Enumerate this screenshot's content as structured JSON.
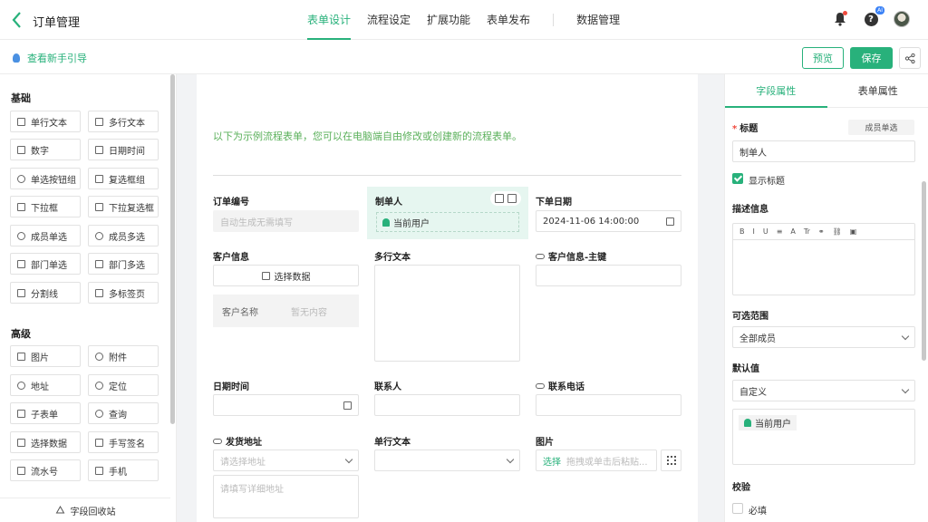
{
  "header": {
    "back_icon": "chevron-left-icon",
    "title": "订单管理",
    "tabs": [
      {
        "label": "表单设计",
        "active": true
      },
      {
        "label": "流程设定",
        "active": false
      },
      {
        "label": "扩展功能",
        "active": false
      },
      {
        "label": "表单发布",
        "active": false
      }
    ],
    "data_tab": "数据管理",
    "ai_badge": "AI",
    "help_glyph": "?"
  },
  "subbar": {
    "guide": "查看新手引导",
    "preview": "预览",
    "save": "保存"
  },
  "left_panel": {
    "basic_title": "基础",
    "basic_items": [
      "单行文本",
      "多行文本",
      "数字",
      "日期时间",
      "单选按钮组",
      "复选框组",
      "下拉框",
      "下拉复选框",
      "成员单选",
      "成员多选",
      "部门单选",
      "部门多选",
      "分割线",
      "多标签页"
    ],
    "advanced_title": "高级",
    "advanced_items": [
      "图片",
      "附件",
      "地址",
      "定位",
      "子表单",
      "查询",
      "选择数据",
      "手写签名",
      "流水号",
      "手机"
    ],
    "recycle": "字段回收站"
  },
  "canvas": {
    "intro": "以下为示例流程表单，您可以在电脑端自由修改或创建新的流程表单。",
    "fields": {
      "order_no_label": "订单编号",
      "order_no_placeholder": "自动生成无需填写",
      "creator_label": "制单人",
      "creator_value": "当前用户",
      "order_date_label": "下单日期",
      "order_date_value": "2024-11-06 14:00:00",
      "customer_label": "客户信息",
      "select_data": "选择数据",
      "customer_name_col": "客户名称",
      "customer_empty": "暂无内容",
      "multiline_label": "多行文本",
      "customer_key_label": "客户信息-主键",
      "datetime_label": "日期时间",
      "contact_label": "联系人",
      "phone_label": "联系电话",
      "ship_addr_label": "发货地址",
      "addr_placeholder": "请选择地址",
      "addr_detail_placeholder": "请填写详细地址",
      "single_line_label": "单行文本",
      "image_label": "图片",
      "image_select": "选择",
      "image_hint": "拖拽或单击后粘贴..."
    }
  },
  "right_panel": {
    "tabs": [
      "字段属性",
      "表单属性"
    ],
    "active_tab": 0,
    "title_label": "标题",
    "field_type": "成员单选",
    "title_value": "制单人",
    "show_title": "显示标题",
    "desc_label": "描述信息",
    "editor_tools": [
      "B",
      "I",
      "U",
      "≡",
      "A",
      "Tr",
      "⚭",
      "⛓",
      "▣"
    ],
    "range_label": "可选范围",
    "range_value": "全部成员",
    "default_label": "默认值",
    "default_value": "自定义",
    "default_user": "当前用户",
    "validate_label": "校验",
    "required": "必填"
  },
  "colors": {
    "accent": "#28b17b",
    "intro_text": "#5ab05a",
    "required_star": "#f04a3e"
  }
}
